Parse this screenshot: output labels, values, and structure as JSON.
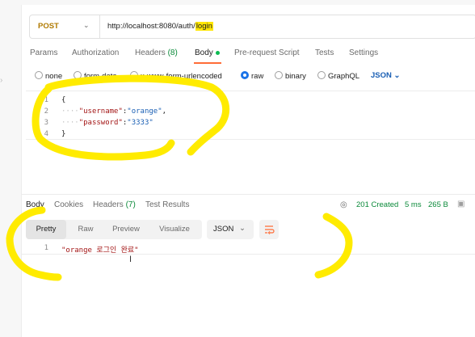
{
  "request": {
    "method": "POST",
    "url_prefix": "http://localhost:8080/auth/",
    "url_highlight": "login"
  },
  "request_tabs": [
    {
      "label": "Params"
    },
    {
      "label": "Authorization"
    },
    {
      "label": "Headers",
      "count": "(8)"
    },
    {
      "label": "Body"
    },
    {
      "label": "Pre-request Script"
    },
    {
      "label": "Tests"
    },
    {
      "label": "Settings"
    }
  ],
  "body_types": [
    "none",
    "form-data",
    "x-www-form-urlencoded",
    "raw",
    "binary",
    "GraphQL"
  ],
  "body_format": "JSON",
  "editor": {
    "line_numbers": [
      "1",
      "2",
      "3",
      "4"
    ],
    "lines": {
      "l1": "{",
      "l2_key": "\"username\"",
      "l2_val": "\"orange\"",
      "l3_key": "\"password\"",
      "l3_val": "\"3333\"",
      "l4": "}"
    }
  },
  "response_tabs": [
    {
      "label": "Body"
    },
    {
      "label": "Cookies"
    },
    {
      "label": "Headers",
      "count": "(7)"
    },
    {
      "label": "Test Results"
    }
  ],
  "response_meta": {
    "status": "201 Created",
    "time": "5 ms",
    "size": "265 B"
  },
  "view_modes": [
    "Pretty",
    "Raw",
    "Preview",
    "Visualize"
  ],
  "response_format": "JSON",
  "response_body": {
    "line_number": "1",
    "text": "\"orange 로그인 완료\""
  },
  "colors": {
    "accent": "#ff6c37",
    "annotation": "#ffeb00",
    "status_green": "#0b8a3a",
    "method": "#b07a00"
  },
  "icons": [
    "chevron-down-icon",
    "globe-icon",
    "save-icon",
    "wrap-lines-icon",
    "text-cursor-icon"
  ]
}
